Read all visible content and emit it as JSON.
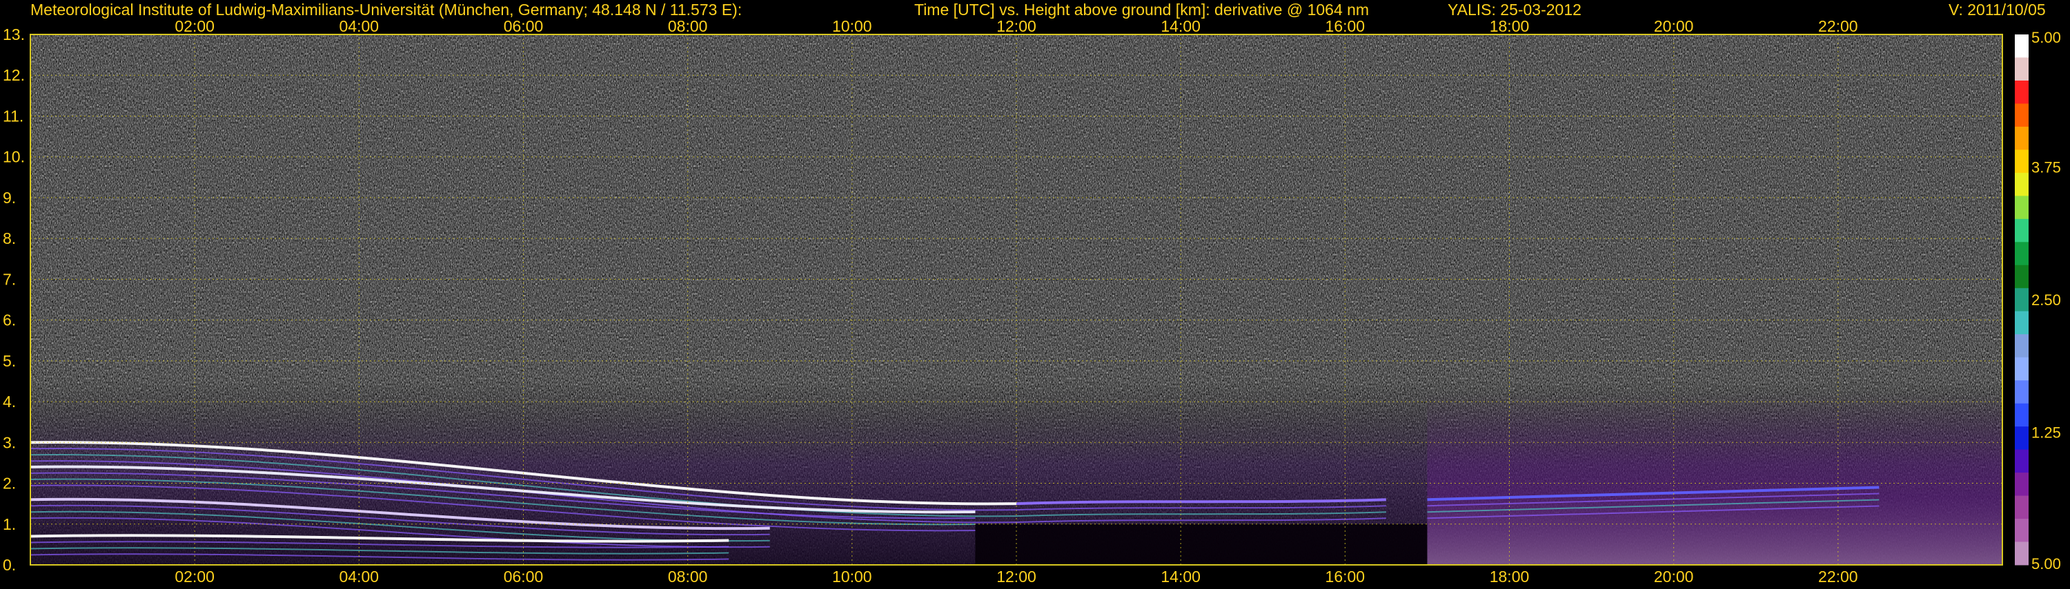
{
  "header": {
    "institute": "Meteorological Institute of Ludwig-Maximilians-Universität (München, Germany; 48.148 N / 11.573 E):",
    "axes_description": "Time [UTC] vs. Height above ground [km]: derivative @ 1064 nm",
    "instrument_date": "YALIS: 25-03-2012",
    "version": "V: 2011/10/05"
  },
  "colors": {
    "text": "#ffd21e",
    "grid": "#d8c820",
    "background": "#000000"
  },
  "chart_data": {
    "type": "heatmap",
    "x_ticks": [
      "02:00",
      "04:00",
      "06:00",
      "08:00",
      "10:00",
      "12:00",
      "14:00",
      "16:00",
      "18:00",
      "20:00",
      "22:00"
    ],
    "x_tick_hours": [
      2,
      4,
      6,
      8,
      10,
      12,
      14,
      16,
      18,
      20,
      22
    ],
    "x_range_hours": [
      0,
      24
    ],
    "y_ticks": [
      "13.",
      "12.",
      "11.",
      "10.",
      "9.",
      "8.",
      "7.",
      "6.",
      "5.",
      "4.",
      "3.",
      "2.",
      "1.",
      "0."
    ],
    "y_tick_values": [
      13,
      12,
      11,
      10,
      9,
      8,
      7,
      6,
      5,
      4,
      3,
      2,
      1,
      0
    ],
    "ylim": [
      0,
      13
    ],
    "colorbar": {
      "tick_labels": [
        "5.00",
        "3.75",
        "2.50",
        "1.25",
        "5.00"
      ],
      "tick_positions": [
        0,
        0.25,
        0.5,
        0.75,
        1
      ],
      "colors": [
        "#ffffff",
        "#e8c8c8",
        "#ff2020",
        "#ff6000",
        "#ffa000",
        "#ffd000",
        "#e8f020",
        "#90e040",
        "#30d080",
        "#10a040",
        "#108020",
        "#20a080",
        "#40c0c0",
        "#80a0e0",
        "#90b0ff",
        "#6080ff",
        "#3050ff",
        "#1020e0",
        "#5010c0",
        "#8020a0",
        "#a040a0",
        "#b060b0",
        "#c090c0"
      ]
    },
    "grid": true,
    "layers": [
      {
        "start_h": 0.0,
        "end_h": 12.0,
        "height_start_km": 3.0,
        "height_end_km": 1.5
      },
      {
        "start_h": 0.0,
        "end_h": 11.5,
        "height_start_km": 2.4,
        "height_end_km": 1.3
      },
      {
        "start_h": 0.0,
        "end_h": 9.0,
        "height_start_km": 1.6,
        "height_end_km": 0.9
      },
      {
        "start_h": 0.0,
        "end_h": 8.5,
        "height_start_km": 0.7,
        "height_end_km": 0.6
      },
      {
        "start_h": 12.0,
        "end_h": 16.5,
        "height_start_km": 1.5,
        "height_end_km": 1.6
      },
      {
        "start_h": 17.0,
        "end_h": 22.5,
        "height_start_km": 1.6,
        "height_end_km": 1.9
      }
    ]
  }
}
